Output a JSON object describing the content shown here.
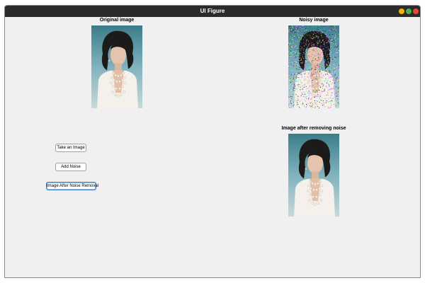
{
  "window": {
    "title": "UI Figure",
    "controls": [
      "minimize-button",
      "maximize-button",
      "close-button"
    ],
    "control_colors": {
      "minimize": "#f0b400",
      "maximize": "#48b14b",
      "close": "#e8453c"
    }
  },
  "panels": {
    "original": {
      "title": "Original image"
    },
    "noisy": {
      "title": "Noisy image"
    },
    "denoised": {
      "title": "Image after removing noise"
    }
  },
  "buttons": {
    "take_image": "Take an Image",
    "add_noise": "Add Noise",
    "after_noise_removal": "Image After Noise Removal"
  },
  "colors": {
    "titlebar": "#2b2b2b",
    "figure_background": "#f0f0f0",
    "focus_accent": "#3a7fd6"
  }
}
